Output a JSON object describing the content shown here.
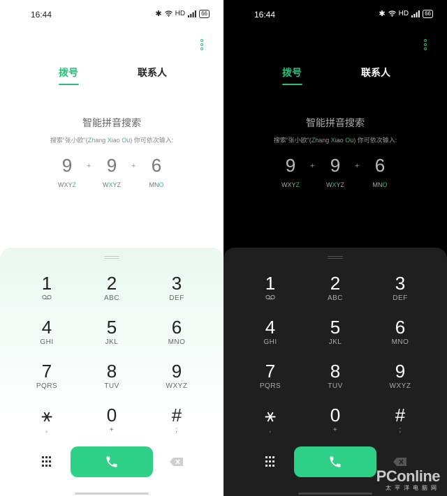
{
  "status_bar": {
    "time": "16:44",
    "network_label": "HD",
    "battery": "66"
  },
  "tabs": [
    {
      "label": "拨号",
      "active": true
    },
    {
      "label": "联系人",
      "active": false
    }
  ],
  "hint": {
    "title": "智能拼音搜索",
    "subtitle_prefix": "搜索“张小欧”(",
    "name_parts": [
      {
        "green": "Z",
        "rest": "hang "
      },
      {
        "green": "X",
        "rest": "iao "
      },
      {
        "green": "O",
        "rest": "u"
      }
    ],
    "subtitle_suffix": ") 你可依次输入:"
  },
  "example_keys": [
    {
      "digit": "9",
      "letters_plain": "WXY",
      "letters_green": "Z"
    },
    {
      "digit": "9",
      "letters_plain": "W",
      "letters_green": "X",
      "letters_after": "YZ"
    },
    {
      "digit": "6",
      "letters_plain": "MN",
      "letters_green": "O"
    }
  ],
  "example_plus": "+",
  "keypad": [
    {
      "digit": "1",
      "letters": "voicemail-icon"
    },
    {
      "digit": "2",
      "letters": "ABC"
    },
    {
      "digit": "3",
      "letters": "DEF"
    },
    {
      "digit": "4",
      "letters": "GHI"
    },
    {
      "digit": "5",
      "letters": "JKL"
    },
    {
      "digit": "6",
      "letters": "MNO"
    },
    {
      "digit": "7",
      "letters": "PQRS"
    },
    {
      "digit": "8",
      "letters": "TUV"
    },
    {
      "digit": "9",
      "letters": "WXYZ"
    },
    {
      "digit": "⚹",
      "letters": ","
    },
    {
      "digit": "0",
      "letters": "+"
    },
    {
      "digit": "#",
      "letters": ";"
    }
  ],
  "icons": {
    "menu": "more-vert-icon",
    "dialpad": "dialpad-icon",
    "call": "phone-icon",
    "delete": "backspace-icon"
  },
  "colors": {
    "accent": "#2bbf7a",
    "call_button": "#2dd086"
  },
  "watermark": {
    "main": "PConline",
    "sub": "太平洋电脑网"
  }
}
